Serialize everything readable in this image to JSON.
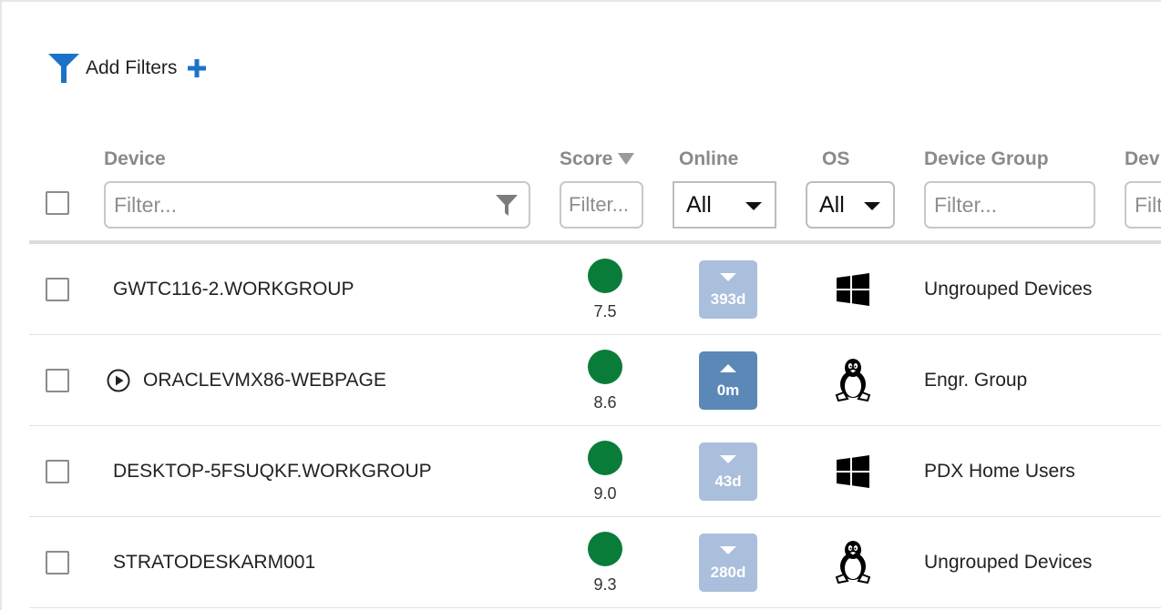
{
  "toolbar": {
    "add_filters_label": "Add Filters"
  },
  "columns": {
    "device": "Device",
    "score": "Score",
    "online": "Online",
    "os": "OS",
    "device_group": "Device Group",
    "next": "Dev"
  },
  "filters": {
    "device_placeholder": "Filter...",
    "score_placeholder": "Filter...",
    "online_value": "All",
    "os_value": "All",
    "group_placeholder": "Filter...",
    "next_placeholder": "Filter..."
  },
  "rows": [
    {
      "device": "GWTC116-2.WORKGROUP",
      "score": "7.5",
      "online": "393d",
      "online_state": "offline",
      "os": "windows-icon",
      "group": "Ungrouped Devices"
    },
    {
      "device": "ORACLEVMX86-WEBPAGE",
      "score": "8.6",
      "online": "0m",
      "online_state": "online",
      "os": "linux-icon",
      "group": "Engr. Group",
      "has_play": true
    },
    {
      "device": "DESKTOP-5FSUQKF.WORKGROUP",
      "score": "9.0",
      "online": "43d",
      "online_state": "offline",
      "os": "windows-icon",
      "group": "PDX Home Users"
    },
    {
      "device": "STRATODESKARM001",
      "score": "9.3",
      "online": "280d",
      "online_state": "offline",
      "os": "linux-icon",
      "group": "Ungrouped Devices"
    }
  ],
  "colors": {
    "brand_blue": "#1a73c8",
    "score_green": "#0a7c3a",
    "badge_offline": "#a9bfdc",
    "badge_online": "#5b88b7"
  }
}
